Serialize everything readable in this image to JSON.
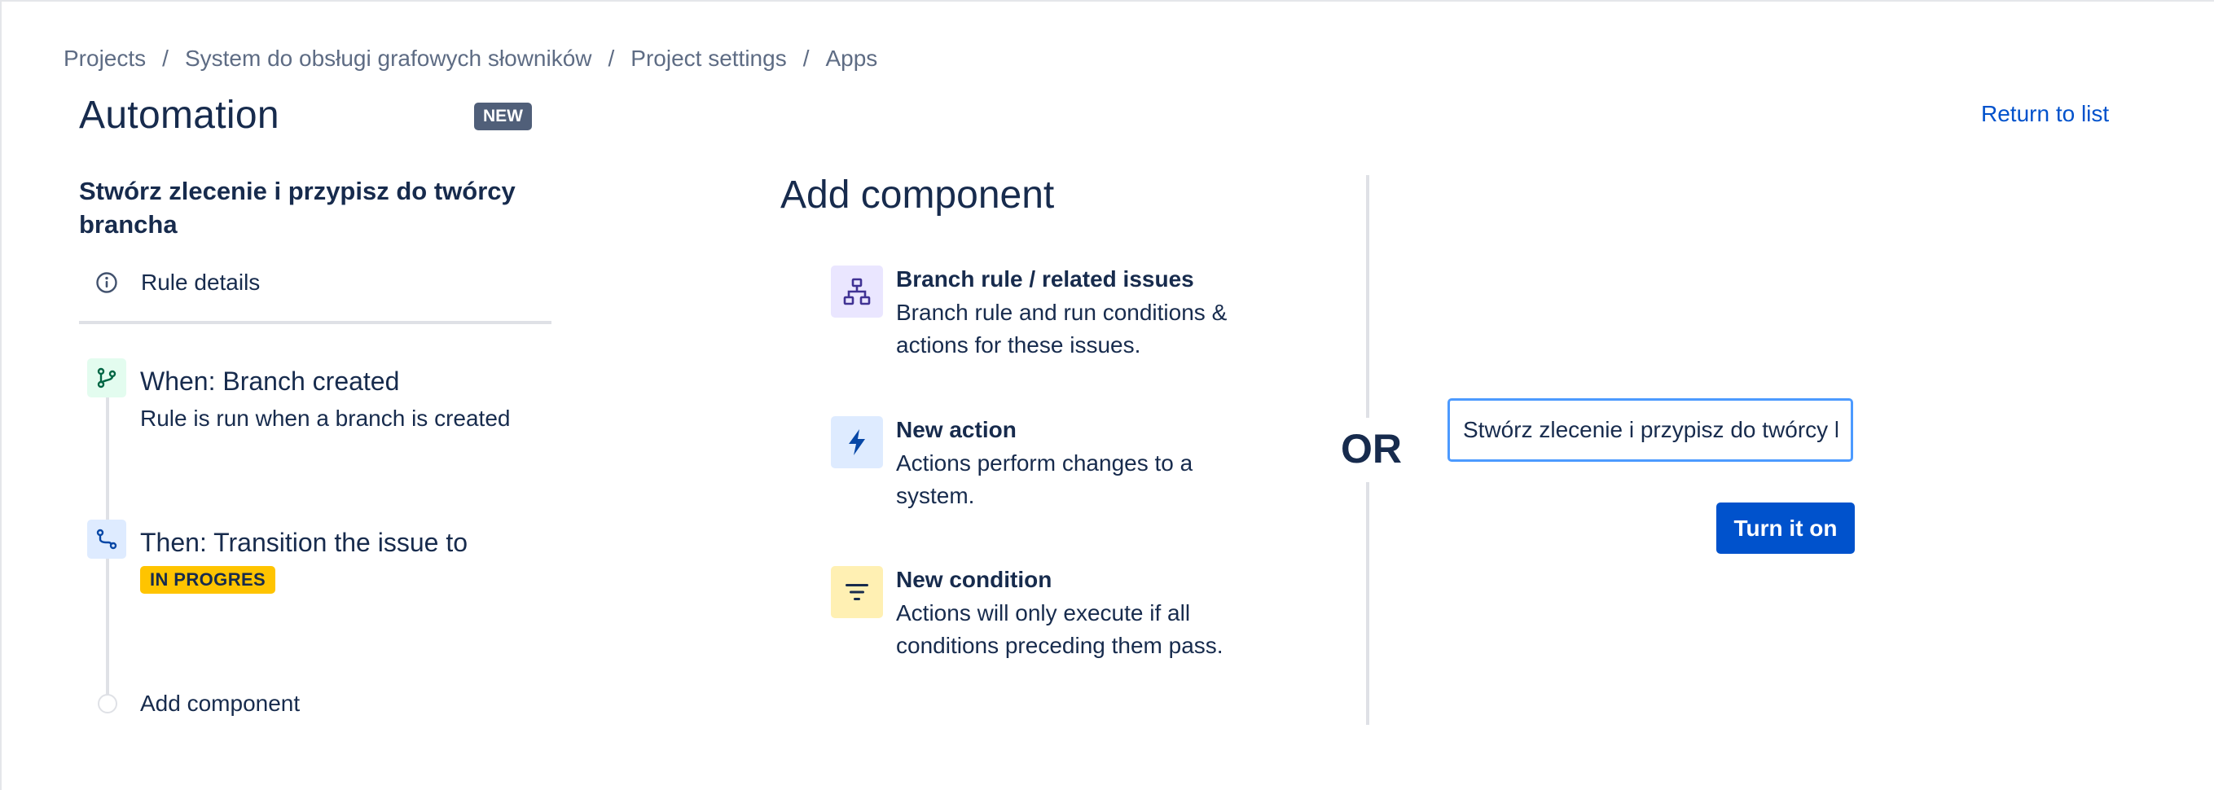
{
  "breadcrumb": [
    {
      "label": "Projects"
    },
    {
      "label": "System do obsługi grafowych słowników"
    },
    {
      "label": "Project settings"
    },
    {
      "label": "Apps"
    }
  ],
  "breadcrumb_separator": "/",
  "header": {
    "title": "Automation",
    "badge": "NEW",
    "return_link": "Return to list"
  },
  "rule": {
    "name": "Stwórz zlecenie i przypisz do twórcy brancha",
    "details_label": "Rule details",
    "trigger": {
      "title": "When: Branch created",
      "description": "Rule is run when a branch is created",
      "icon": "branch-icon",
      "icon_color": "#006644",
      "icon_bg": "#e3fcef"
    },
    "action": {
      "title": "Then: Transition the issue to",
      "status": "IN PROGRES",
      "status_color": "#ffc400",
      "icon": "transition-icon",
      "icon_color": "#0747a6",
      "icon_bg": "#deebff"
    },
    "add_component_label": "Add component"
  },
  "add_component": {
    "heading": "Add component",
    "options": [
      {
        "title": "Branch rule / related issues",
        "description": "Branch rule and run conditions & actions for these issues.",
        "icon": "hierarchy-icon",
        "icon_bg": "#eae6ff",
        "icon_color": "#403294"
      },
      {
        "title": "New action",
        "description": "Actions perform changes to a system.",
        "icon": "lightning-icon",
        "icon_bg": "#deebff",
        "icon_color": "#0747a6"
      },
      {
        "title": "New condition",
        "description": "Actions will only execute if all conditions preceding them pass.",
        "icon": "filter-icon",
        "icon_bg": "#fff0b3",
        "icon_color": "#172b4d"
      }
    ]
  },
  "divider": {
    "or_label": "OR"
  },
  "publish": {
    "rule_name_value": "Stwórz zlecenie i przypisz do twórcy brancha",
    "turn_on_label": "Turn it on",
    "accent": "#0052cc"
  }
}
